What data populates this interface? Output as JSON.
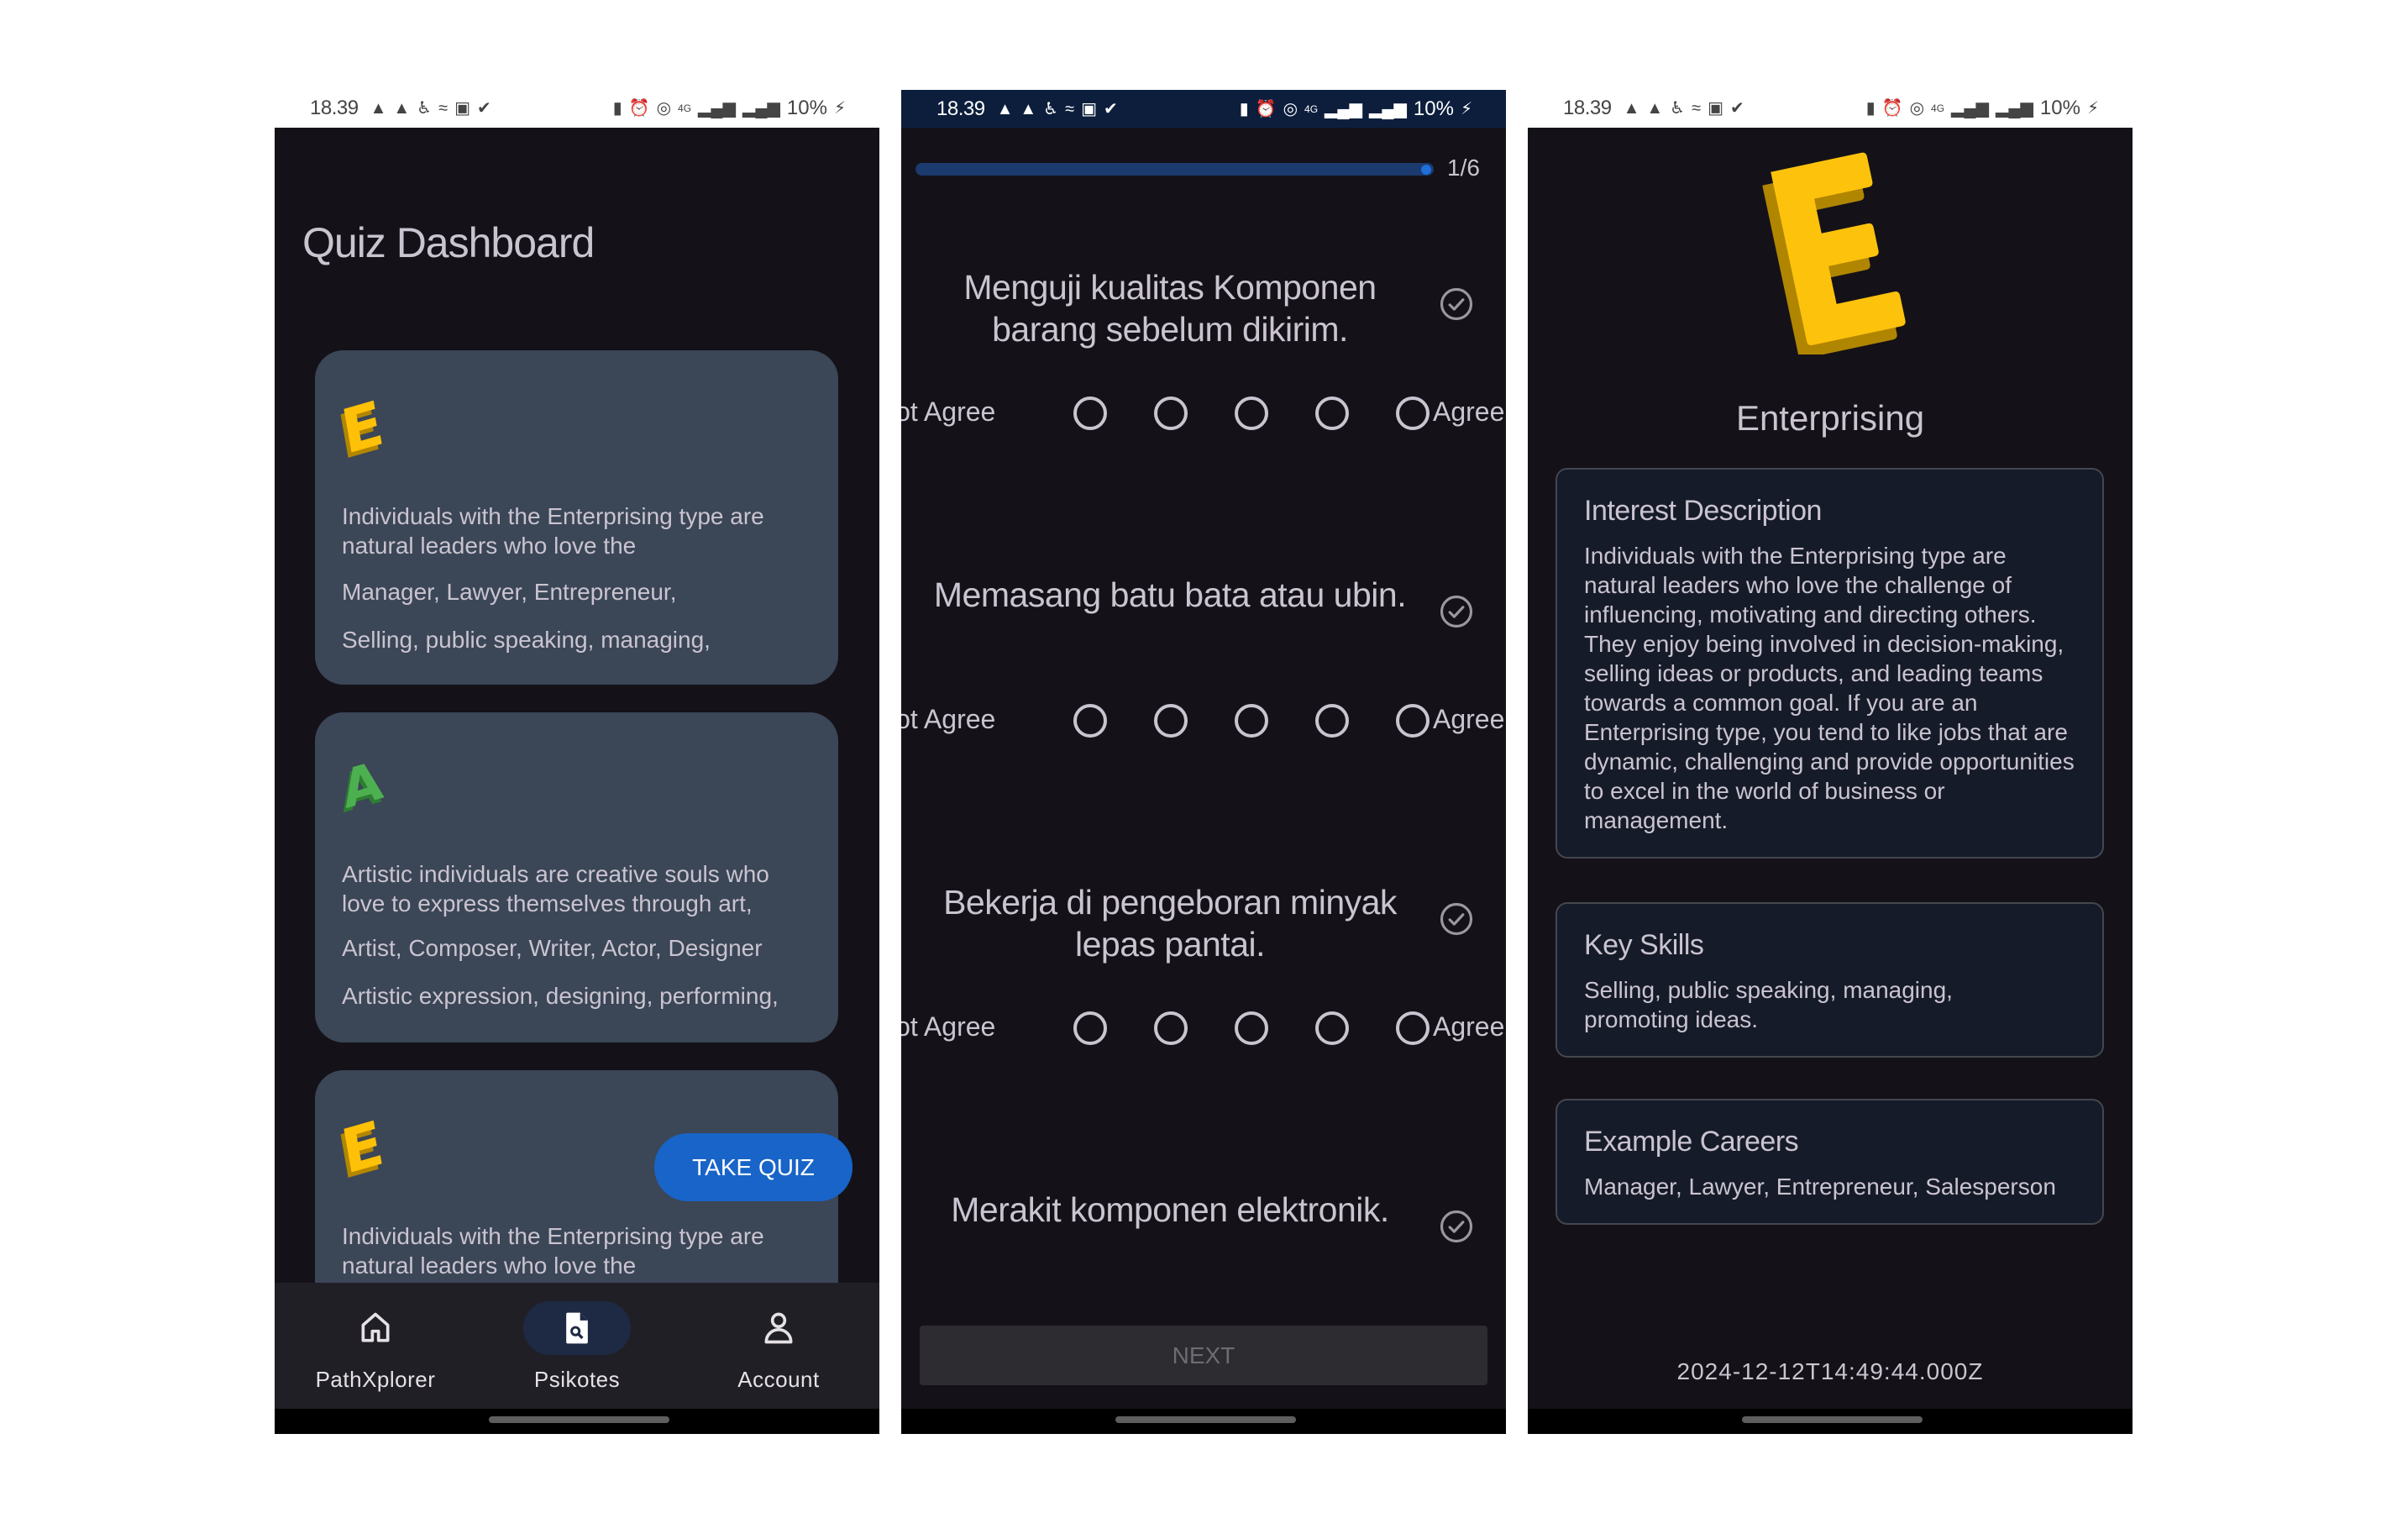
{
  "status_bar": {
    "time": "18.39",
    "left_icons": [
      "warning-icon",
      "warning-icon",
      "accessibility-icon",
      "swim-icon",
      "image-icon",
      "check-circle-icon"
    ],
    "right_icons": [
      "recycle-battery-icon",
      "alarm-icon",
      "hotspot-icon",
      "4g-data-icon",
      "signal-icon",
      "signal-icon"
    ],
    "battery": "10%"
  },
  "dashboard": {
    "title": "Quiz Dashboard",
    "cards": [
      {
        "letter": "E",
        "letter_color": "#ffc107",
        "description": "Individuals with the Enterprising type are natural leaders who love the",
        "careers": "Manager, Lawyer, Entrepreneur,",
        "skills": "Selling, public speaking, managing,"
      },
      {
        "letter": "A",
        "letter_color": "#4cb050",
        "description": "Artistic individuals are creative souls who love to express themselves through art,",
        "careers": "Artist, Composer, Writer, Actor, Designer",
        "skills": "Artistic expression, designing, performing,"
      },
      {
        "letter": "E",
        "letter_color": "#ffc107",
        "description": "Individuals with the Enterprising type are natural leaders who love the"
      }
    ],
    "take_quiz_label": "TAKE QUIZ",
    "nav": [
      {
        "label": "PathXplorer",
        "icon": "home-icon",
        "active": false
      },
      {
        "label": "Psikotes",
        "icon": "document-search-icon",
        "active": true
      },
      {
        "label": "Account",
        "icon": "person-icon",
        "active": false
      }
    ]
  },
  "quiz": {
    "progress_text": "1/6",
    "progress_fraction": 1.0,
    "scale_left": "Not Agree",
    "scale_right": "Agree",
    "scale_points": 5,
    "questions": [
      {
        "text": "Menguji kualitas Komponen barang sebelum dikirim.",
        "selected": null
      },
      {
        "text": "Memasang batu bata atau ubin.",
        "selected": null
      },
      {
        "text": "Bekerja di pengeboran minyak lepas pantai.",
        "selected": null
      },
      {
        "text": "Merakit komponen elektronik.",
        "selected": null
      }
    ],
    "next_label": "NEXT",
    "next_enabled": false
  },
  "result": {
    "letter": "E",
    "type_name": "Enterprising",
    "sections": [
      {
        "title": "Interest Description",
        "body": "Individuals with the Enterprising type are natural leaders who love the challenge of influencing, motivating and directing others. They enjoy being involved in decision-making, selling ideas or products, and leading teams towards a common goal. If you are an Enterprising type, you tend to like jobs that are dynamic, challenging and provide opportunities to excel in the world of business or management."
      },
      {
        "title": "Key Skills",
        "body": "Selling, public speaking, managing, promoting ideas."
      },
      {
        "title": "Example Careers",
        "body": "Manager, Lawyer, Entrepreneur, Salesperson"
      }
    ],
    "timestamp": "2024-12-12T14:49:44.000Z"
  },
  "colors": {
    "background": "#141218",
    "card": "#3b4657",
    "info_card": "#161b29",
    "accent_blue": "#1864c8",
    "enterprising_yellow": "#ffc107",
    "artistic_green": "#4cb050",
    "text": "#cac4d0"
  }
}
